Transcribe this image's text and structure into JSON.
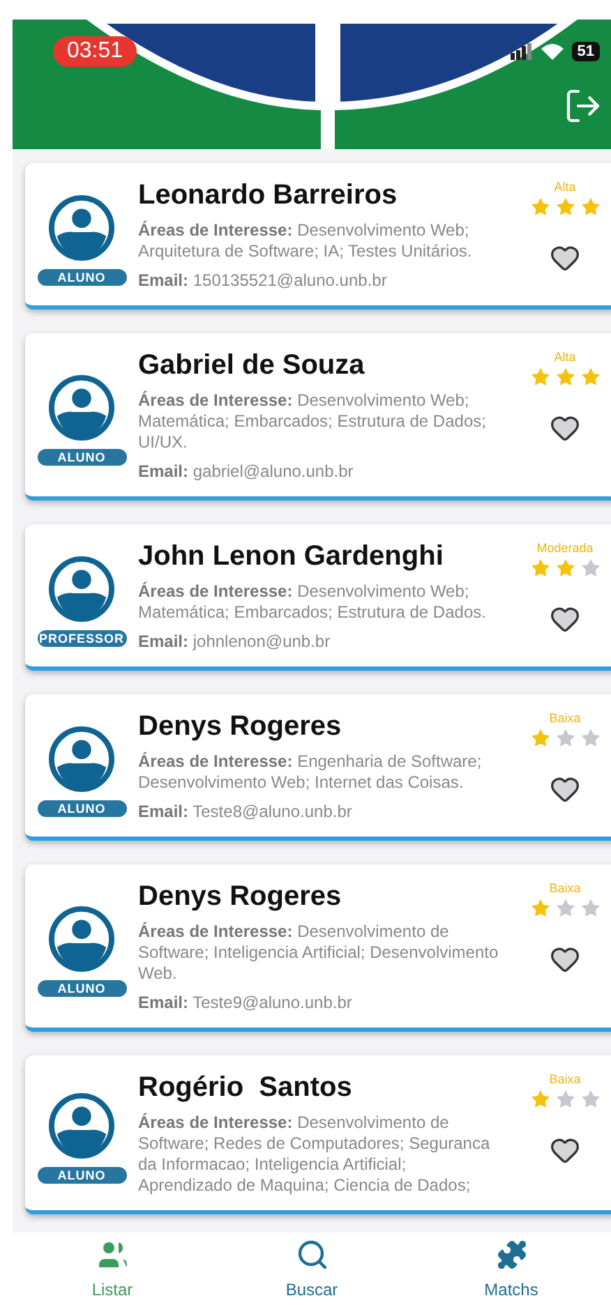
{
  "status_bar": {
    "time": "03:51",
    "battery": "51"
  },
  "cards": [
    {
      "name": "Leonardo Barreiros",
      "role": "ALUNO",
      "areas": "**Áreas de Interesse:** Desenvolvimento Web; Arquitetura de Software; IA; Testes Unitários.",
      "email": "**Email:** 150135521@aluno.unb.br",
      "level_label": "Alta",
      "stars": 3,
      "favorite": false
    },
    {
      "name": "Gabriel de Souza",
      "role": "ALUNO",
      "areas": "**Áreas de Interesse:** Desenvolvimento Web; Matemática; Embarcados; Estrutura de Dados; UI/UX.",
      "email": "**Email:** gabriel@aluno.unb.br",
      "level_label": "Alta",
      "stars": 3,
      "favorite": false
    },
    {
      "name": "John Lenon Gardenghi",
      "role": "PROFESSOR",
      "areas": "**Áreas de Interesse:** Desenvolvimento Web; Matemática; Embarcados; Estrutura de Dados.",
      "email": "**Email:** johnlenon@unb.br",
      "level_label": "Moderada",
      "stars": 2,
      "favorite": false
    },
    {
      "name": "Denys Rogeres",
      "role": "ALUNO",
      "areas": "**Áreas de Interesse:** Engenharia de Software; Desenvolvimento Web; Internet das Coisas.",
      "email": "**Email:** Teste8@aluno.unb.br",
      "level_label": "Baixa",
      "stars": 1,
      "favorite": false
    },
    {
      "name": "Denys Rogeres",
      "role": "ALUNO",
      "areas": "**Áreas de Interesse:** Desenvolvimento de Software; Inteligencia Artificial; Desenvolvimento Web.",
      "email": "**Email:** Teste9@aluno.unb.br",
      "level_label": "Baixa",
      "stars": 1,
      "favorite": false
    },
    {
      "name": "Rogério  Santos",
      "role": "ALUNO",
      "areas": "**Áreas de Interesse:** Desenvolvimento de Software; Redes de Computadores; Seguranca da Informacao; Inteligencia Artificial; Aprendizado de Maquina; Ciencia de Dados;",
      "level_label": "Baixa",
      "stars": 1,
      "favorite": false
    }
  ],
  "nav": [
    {
      "label": "Listar",
      "kind": "people",
      "selected": true
    },
    {
      "label": "Buscar",
      "kind": "search",
      "selected": false
    },
    {
      "label": "Matchs",
      "kind": "puzzle",
      "selected": false
    }
  ]
}
